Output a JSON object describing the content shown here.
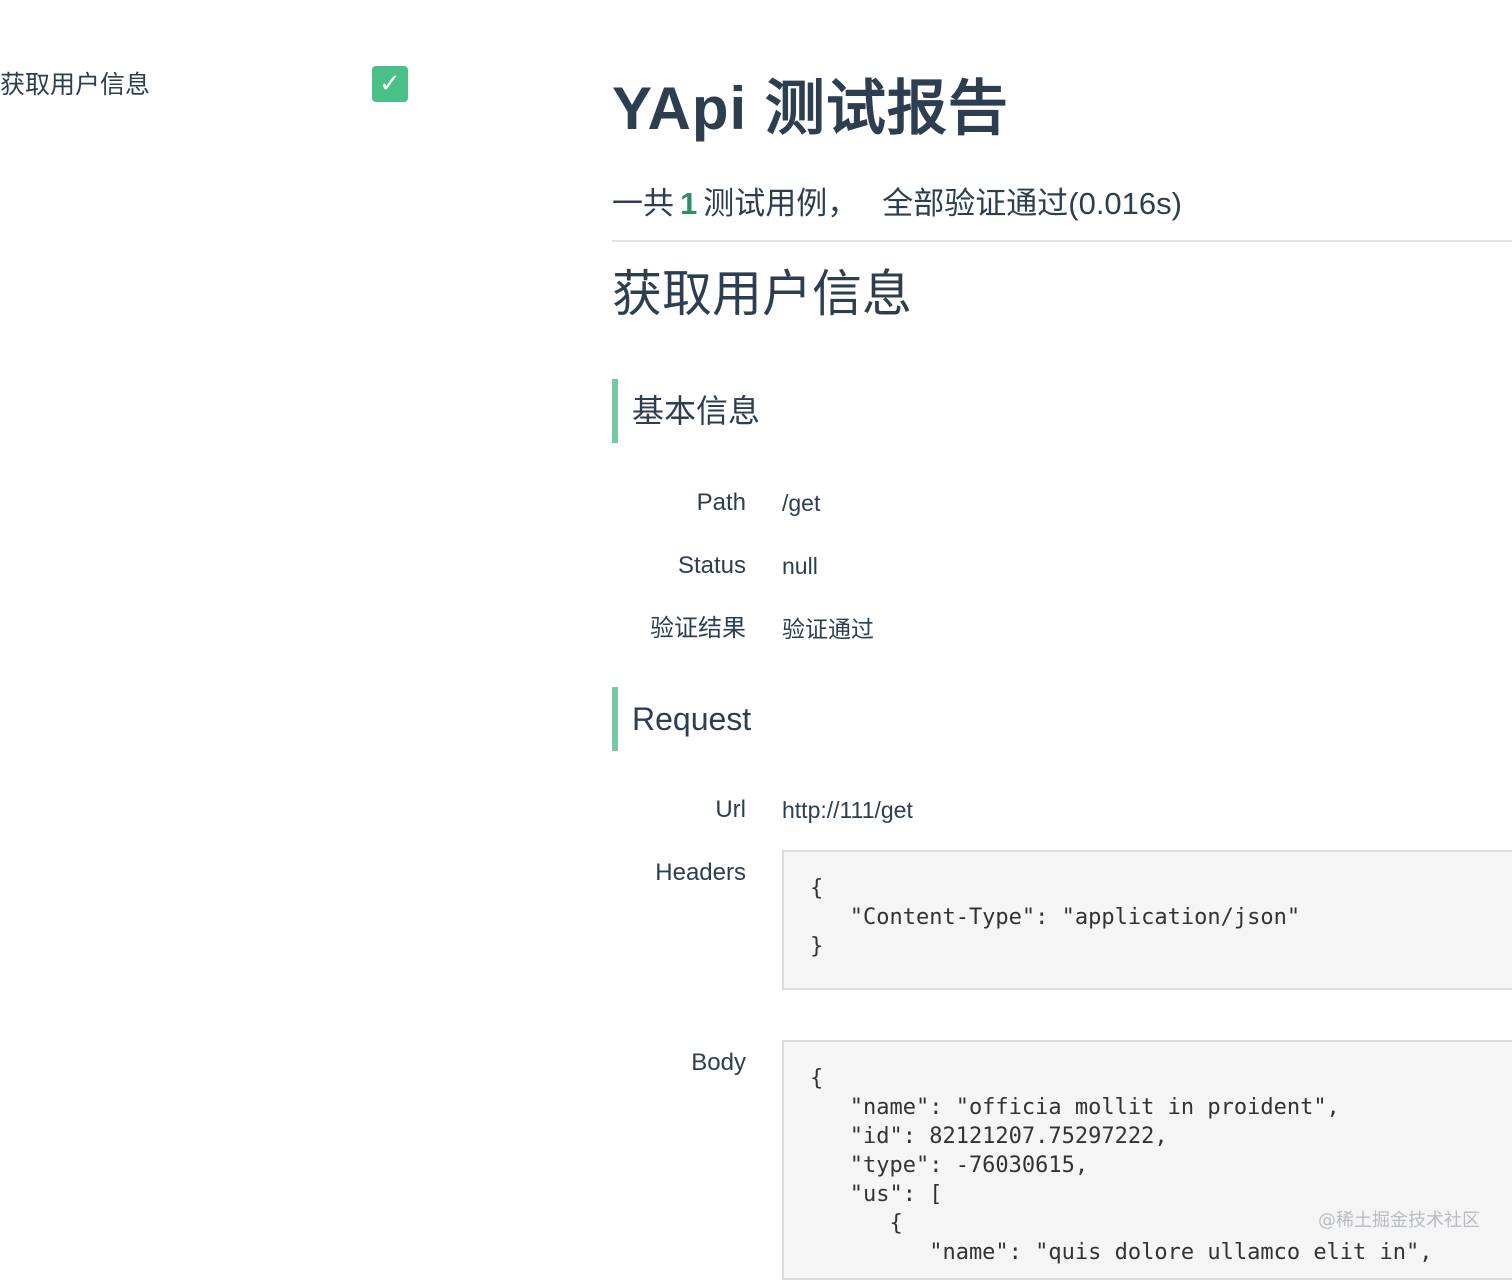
{
  "sidebar": {
    "items": [
      {
        "label": "获取用户信息",
        "status_icon": "check-icon",
        "status_glyph": "✓"
      }
    ]
  },
  "report": {
    "title": "YApi 测试报告",
    "summary": {
      "prefix": "一共",
      "count": "1",
      "middle": "测试用例，",
      "result": "全部验证通过(0.016s)"
    }
  },
  "case": {
    "title": "获取用户信息",
    "basic_info": {
      "heading": "基本信息",
      "rows": [
        {
          "label": "Path",
          "value": "/get"
        },
        {
          "label": "Status",
          "value": "null"
        },
        {
          "label": "验证结果",
          "value": "验证通过"
        }
      ]
    },
    "request": {
      "heading": "Request",
      "url_label": "Url",
      "url_value": "http://111/get",
      "headers_label": "Headers",
      "headers_code": "{\n   \"Content-Type\": \"application/json\"\n}",
      "body_label": "Body",
      "body_code": "{\n   \"name\": \"officia mollit in proident\",\n   \"id\": 82121207.75297222,\n   \"type\": -76030615,\n   \"us\": [\n      {\n         \"name\": \"quis dolore ullamco elit in\","
    }
  },
  "watermark": "@稀土掘金技术社区",
  "colors": {
    "accent": "#48c087",
    "section_bar": "#76c9a2",
    "count": "#2f8f63",
    "text": "#2c3e50",
    "code_bg": "#f5f5f5"
  }
}
